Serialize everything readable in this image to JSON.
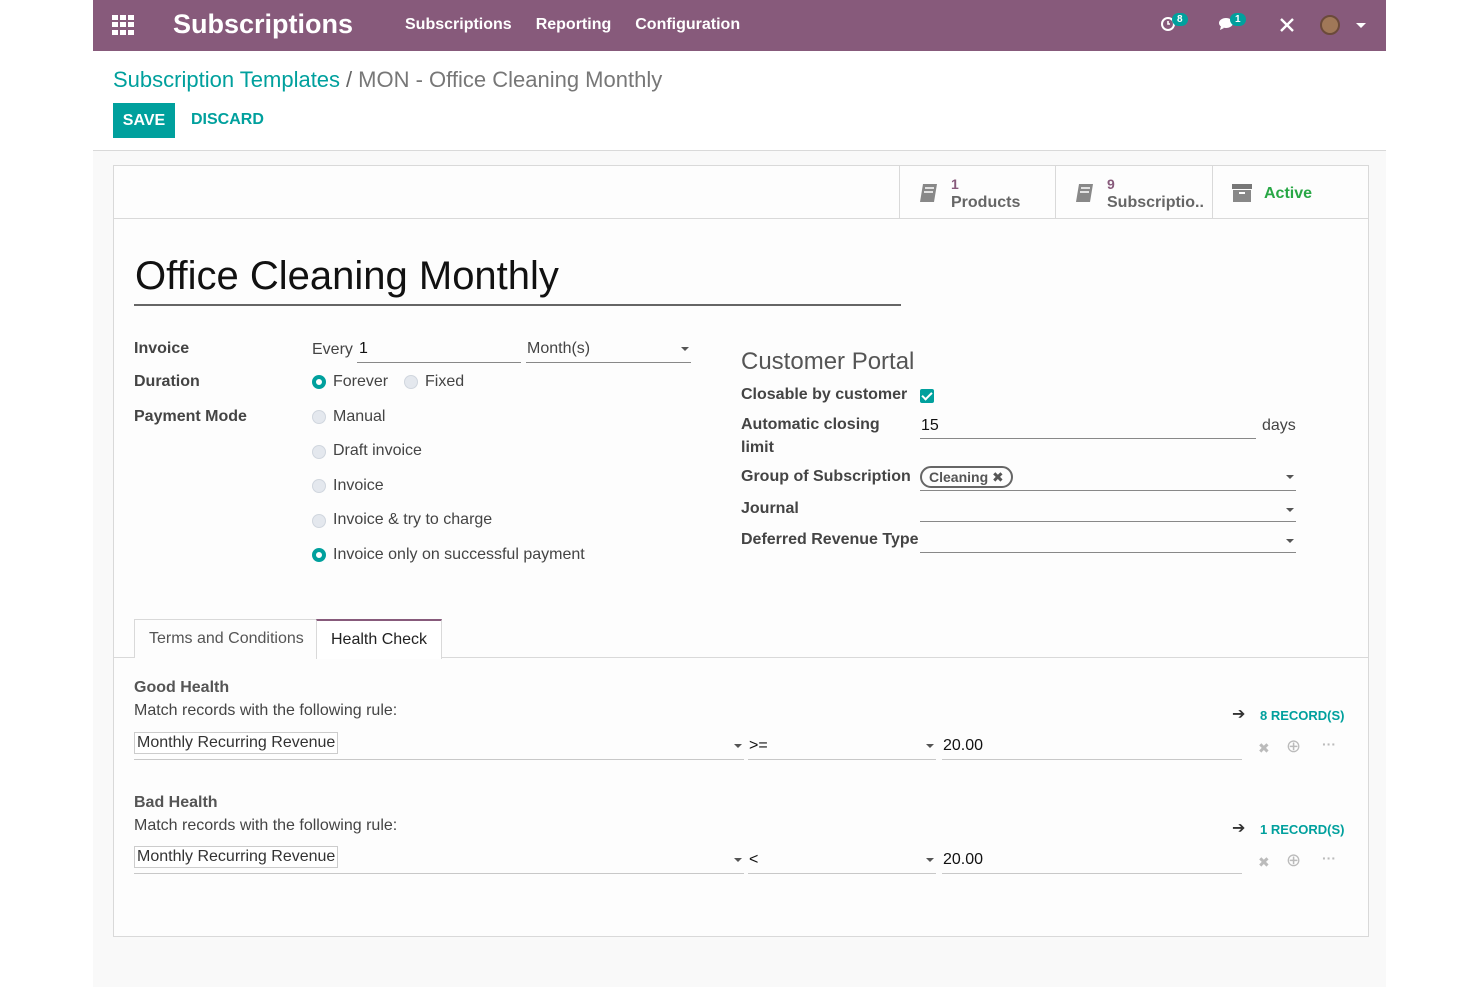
{
  "topbar": {
    "brand": "Subscriptions",
    "menu": [
      "Subscriptions",
      "Reporting",
      "Configuration"
    ],
    "activity_count": "8",
    "message_count": "1"
  },
  "control": {
    "breadcrumb_parent": "Subscription Templates",
    "breadcrumb_sep": "/",
    "breadcrumb_current": "MON - Office Cleaning Monthly",
    "save_label": "SAVE",
    "discard_label": "DISCARD"
  },
  "stats": {
    "products_count": "1",
    "products_label": "Products",
    "subscriptions_count": "9",
    "subscriptions_label": "Subscriptio...",
    "active_label": "Active"
  },
  "form": {
    "name": "Office Cleaning Monthly",
    "invoice_label": "Invoice",
    "every_label": "Every",
    "every_value": "1",
    "period_value": "Month(s)",
    "duration_label": "Duration",
    "duration_options": [
      "Forever",
      "Fixed"
    ],
    "payment_mode_label": "Payment Mode",
    "payment_options": [
      "Manual",
      "Draft invoice",
      "Invoice",
      "Invoice & try to charge",
      "Invoice only on successful payment"
    ]
  },
  "portal": {
    "title": "Customer Portal",
    "closable_label": "Closable by customer",
    "closing_label_1": "Automatic closing",
    "closing_label_2": "limit",
    "closing_value": "15",
    "closing_unit": "days",
    "group_label": "Group of Subscription",
    "group_tag": "Cleaning",
    "journal_label": "Journal",
    "deferred_label": "Deferred Revenue Type"
  },
  "tabs": [
    "Terms and Conditions",
    "Health Check"
  ],
  "health": {
    "good_title": "Good Health",
    "good_sub": "Match records with the following rule:",
    "good_records": "8 RECORD(S)",
    "good_field": "Monthly Recurring Revenue",
    "good_operator": ">=",
    "good_value": "20.00",
    "bad_title": "Bad Health",
    "bad_sub": "Match records with the following rule:",
    "bad_records": "1 RECORD(S)",
    "bad_field": "Monthly Recurring Revenue",
    "bad_operator": "<",
    "bad_value": "20.00"
  }
}
